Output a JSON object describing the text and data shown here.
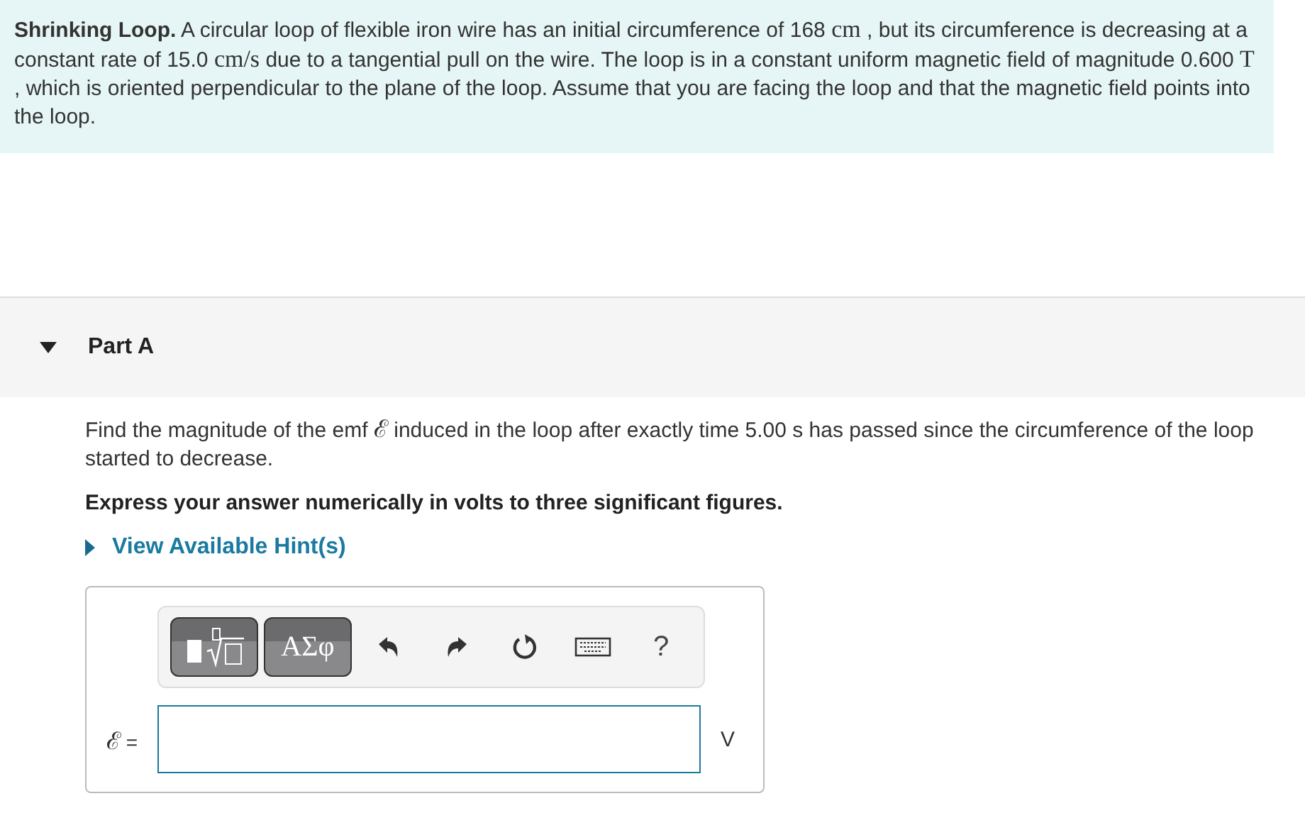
{
  "intro": {
    "title": "Shrinking Loop.",
    "segments": [
      {
        "kind": "text",
        "text": " A circular loop of flexible iron wire has an initial circumference of 168 "
      },
      {
        "kind": "math",
        "text": "cm"
      },
      {
        "kind": "text",
        "text": " , but its circumference is decreasing at a constant rate of 15.0 "
      },
      {
        "kind": "math",
        "text": "cm/s"
      },
      {
        "kind": "text",
        "text": " due to a tangential pull on the wire. The loop is in a constant uniform magnetic field of magnitude 0.600 "
      },
      {
        "kind": "math",
        "text": "T"
      },
      {
        "kind": "text",
        "text": " , which is oriented perpendicular to the plane of the loop. Assume that you are facing the loop and that the magnetic field points into the loop."
      }
    ]
  },
  "part": {
    "label": "Part A",
    "expanded": true
  },
  "question": {
    "segments": [
      {
        "kind": "text",
        "text": "Find the magnitude of the emf "
      },
      {
        "kind": "math",
        "text": "ℰ"
      },
      {
        "kind": "text",
        "text": " induced in the loop after exactly time 5.00 s has passed since the circumference of the loop started to decrease."
      }
    ]
  },
  "instruction": "Express your answer numerically in volts to three significant figures.",
  "hint": {
    "label": "View Available Hint(s)",
    "expanded": false
  },
  "toolbar": {
    "greek": "ΑΣφ",
    "help": "?"
  },
  "answer": {
    "label": "ℰ",
    "equals": "=",
    "unit": "V"
  }
}
